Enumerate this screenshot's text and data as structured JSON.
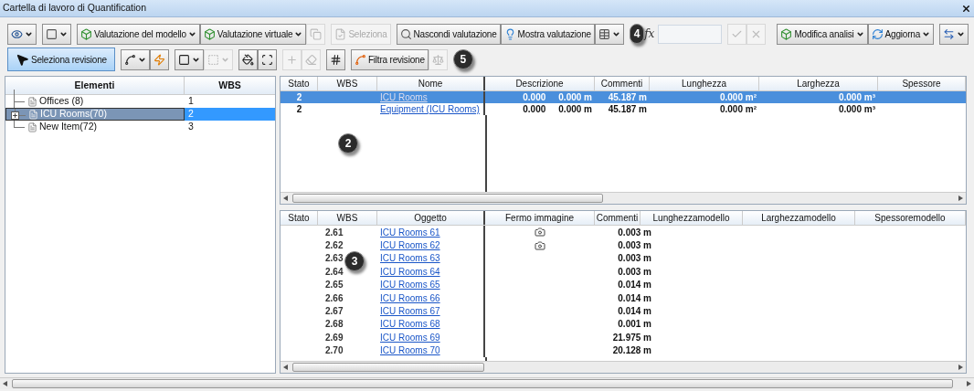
{
  "window": {
    "title": "Cartella di lavoro di Quantification"
  },
  "toolbar_rows": [
    {
      "items": [
        {
          "kind": "group",
          "buttons": [
            {
              "dropdown": true,
              "disabled": false
            }
          ]
        },
        {
          "kind": "group",
          "buttons": [
            {
              "dropdown": true,
              "disabled": false
            }
          ]
        },
        {
          "kind": "group",
          "buttons": [
            {
              "label": "Valutazione del modello",
              "dropdown": true,
              "disabled": false
            },
            {
              "label": "Valutazione virtuale",
              "dropdown": true,
              "disabled": false
            },
            {
              "dropdown": false,
              "disabled": true
            }
          ]
        },
        {
          "kind": "group",
          "buttons": [
            {
              "label": "Seleziona",
              "dropdown": false,
              "disabled": true
            }
          ]
        },
        {
          "kind": "group",
          "buttons": [
            {
              "label": "Nascondi valutazione",
              "dropdown": false,
              "disabled": false
            },
            {
              "label": "Mostra valutazione",
              "dropdown": false,
              "disabled": false
            },
            {
              "dropdown": true,
              "disabled": false
            }
          ]
        },
        {
          "kind": "badge",
          "text": "4"
        },
        {
          "kind": "formula",
          "text": "fx"
        },
        {
          "kind": "field"
        },
        {
          "kind": "group",
          "buttons": [
            {
              "dropdown": false,
              "disabled": true
            },
            {
              "dropdown": false,
              "disabled": true
            }
          ]
        },
        {
          "kind": "spacer"
        },
        {
          "kind": "group",
          "buttons": [
            {
              "label": "Modifica analisi",
              "dropdown": true,
              "disabled": false
            },
            {
              "label": "Aggiorna",
              "dropdown": true,
              "disabled": false
            }
          ]
        },
        {
          "kind": "group",
          "buttons": [
            {
              "dropdown": true,
              "disabled": false
            }
          ]
        }
      ]
    },
    {
      "items": [
        {
          "kind": "group",
          "buttons": [
            {
              "label": "Seleziona revisione",
              "dropdown": false,
              "disabled": false,
              "selected": true
            }
          ]
        },
        {
          "kind": "group",
          "buttons": [
            {
              "dropdown": true,
              "disabled": false
            },
            {
              "dropdown": false,
              "disabled": false
            }
          ]
        },
        {
          "kind": "group",
          "buttons": [
            {
              "dropdown": true,
              "disabled": false
            },
            {
              "dropdown": true,
              "disabled": true
            }
          ]
        },
        {
          "kind": "group",
          "buttons": [
            {
              "dropdown": false,
              "disabled": false
            },
            {
              "dropdown": false,
              "disabled": false
            }
          ]
        },
        {
          "kind": "group",
          "buttons": [
            {
              "dropdown": false,
              "disabled": true
            },
            {
              "dropdown": false,
              "disabled": true
            }
          ]
        },
        {
          "kind": "group",
          "buttons": [
            {
              "dropdown": false,
              "disabled": false
            }
          ]
        },
        {
          "kind": "group",
          "buttons": [
            {
              "label": "Filtra revisione",
              "dropdown": false,
              "disabled": false
            },
            {
              "dropdown": false,
              "disabled": true
            }
          ]
        },
        {
          "kind": "badge",
          "text": "5"
        }
      ]
    }
  ],
  "tree": {
    "columns": [
      "Elementi",
      "WBS"
    ],
    "items": [
      {
        "name": "Offices (8)",
        "wbs": "1",
        "expandable": false,
        "selected": false
      },
      {
        "name": "ICU Rooms(70)",
        "wbs": "2",
        "expandable": true,
        "selected": true
      },
      {
        "name": "New Item(72)",
        "wbs": "3",
        "expandable": false,
        "selected": false
      }
    ]
  },
  "upper_grid": {
    "columns": [
      "Stato",
      "WBS",
      "Nome",
      "Descrizione",
      "Commenti",
      "Lunghezza",
      "Larghezza",
      "Spessore"
    ],
    "callout": "2",
    "rows": [
      {
        "stato": "2",
        "nome": "ICU Rooms",
        "descrizione_1": "0.000",
        "descrizione_2": "0.000 m",
        "commenti": "45.187 m",
        "lunghezza": "0.000 m²",
        "larghezza": "0.000 m³",
        "selected": true
      },
      {
        "stato": "2",
        "nome": "Equipment (ICU Rooms)",
        "descrizione_1": "0.000",
        "descrizione_2": "0.000 m",
        "commenti": "45.187 m",
        "lunghezza": "0.000 m²",
        "larghezza": "0.000 m³",
        "selected": false
      }
    ]
  },
  "lower_grid": {
    "columns": [
      "Stato",
      "WBS",
      "Oggetto",
      "Fermo immagine",
      "Commenti",
      "Lunghezzamodello",
      "Larghezzamodello",
      "Spessoremodello"
    ],
    "callout": "3",
    "rows": [
      {
        "wbs": "2.61",
        "oggetto": "ICU Rooms 61",
        "snapshot": true,
        "commenti": "0.003 m"
      },
      {
        "wbs": "2.62",
        "oggetto": "ICU Rooms 62",
        "snapshot": true,
        "commenti": "0.003 m"
      },
      {
        "wbs": "2.63",
        "oggetto": "ICU Rooms 63",
        "snapshot": false,
        "commenti": "0.003 m"
      },
      {
        "wbs": "2.64",
        "oggetto": "ICU Rooms 64",
        "snapshot": false,
        "commenti": "0.003 m"
      },
      {
        "wbs": "2.65",
        "oggetto": "ICU Rooms 65",
        "snapshot": false,
        "commenti": "0.014 m"
      },
      {
        "wbs": "2.66",
        "oggetto": "ICU Rooms 66",
        "snapshot": false,
        "commenti": "0.014 m"
      },
      {
        "wbs": "2.67",
        "oggetto": "ICU Rooms 67",
        "snapshot": false,
        "commenti": "0.014 m"
      },
      {
        "wbs": "2.68",
        "oggetto": "ICU Rooms 68",
        "snapshot": false,
        "commenti": "0.001 m"
      },
      {
        "wbs": "2.69",
        "oggetto": "ICU Rooms 69",
        "snapshot": false,
        "commenti": "21.975 m"
      },
      {
        "wbs": "2.70",
        "oggetto": "ICU Rooms 70",
        "snapshot": false,
        "commenti": "20.128 m"
      }
    ]
  }
}
